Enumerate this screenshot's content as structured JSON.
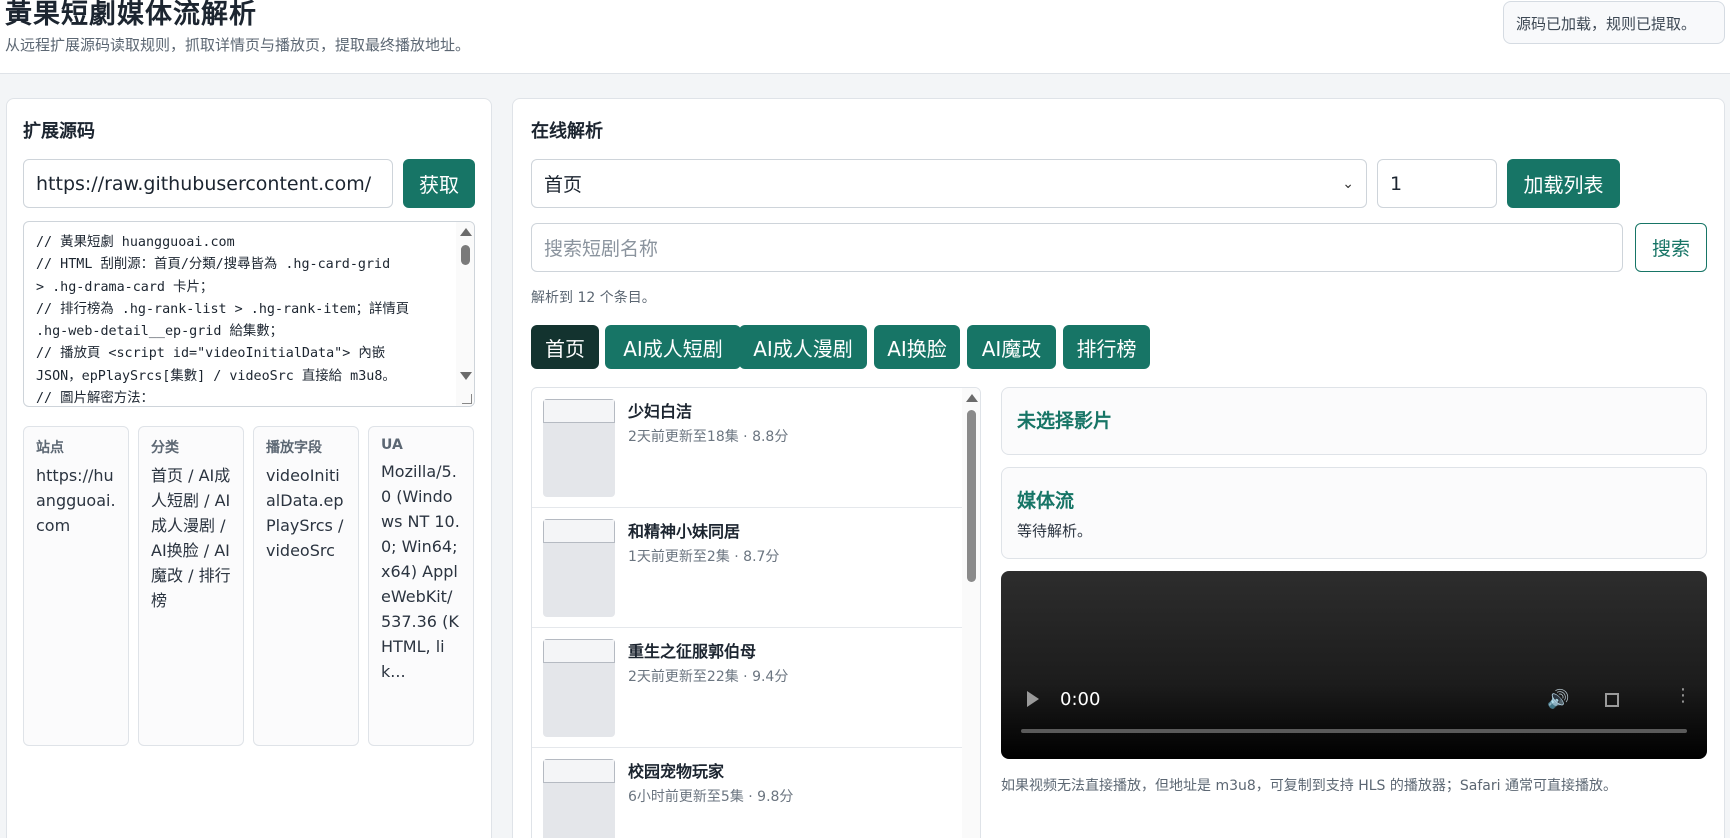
{
  "header": {
    "title": "黃果短劇媒体流解析",
    "subtitle": "从远程扩展源码读取规则，抓取详情页与播放页，提取最终播放地址。",
    "toast": "源码已加载，规则已提取。"
  },
  "left": {
    "title": "扩展源码",
    "url_value": "https://raw.githubusercontent.com/",
    "fetch_label": "获取",
    "code": "// 黃果短劇 huangguoai.com\n// HTML 刮削源：首頁/分類/搜尋皆為 .hg-card-grid\n> .hg-drama-card 卡片；\n// 排行榜為 .hg-rank-list > .hg-rank-item；詳情頁\n.hg-web-detail__ep-grid 給集數；\n// 播放頁 <script id=\"videoInitialData\"> 內嵌\nJSON，epPlaySrcs[集數] / videoSrc 直接給 m3u8。\n// 圖片解密方法：",
    "cards": [
      {
        "key": "站点",
        "value": "https://huangguoai.com"
      },
      {
        "key": "分类",
        "value": "首页 / AI成人短剧 / AI成人漫剧 / AI换脸 / AI魔改 / 排行榜"
      },
      {
        "key": "播放字段",
        "value": "videoInitialData.epPlaySrcs / videoSrc"
      },
      {
        "key": "UA",
        "value": "Mozilla/5.0 (Windows NT 10.0; Win64; x64) AppleWebKit/537.36 (KHTML, lik..."
      }
    ]
  },
  "right": {
    "title": "在线解析",
    "category_select": "首页",
    "page_value": "1",
    "load_label": "加载列表",
    "search_placeholder": "搜索短剧名称",
    "search_label": "搜索",
    "status": "解析到 12 个条目。",
    "categories": [
      "首页",
      "AI成人短剧",
      "AI成人漫剧",
      "AI换脸",
      "AI魔改",
      "排行榜"
    ],
    "items": [
      {
        "name": "少妇白洁",
        "meta": "2天前更新至18集 · 8.8分"
      },
      {
        "name": "和精神小妹同居",
        "meta": "1天前更新至2集 · 8.7分"
      },
      {
        "name": "重生之征服郭伯母",
        "meta": "2天前更新至22集 · 9.4分"
      },
      {
        "name": "校园宠物玩家",
        "meta": "6小时前更新至5集 · 9.8分"
      }
    ],
    "selected_title": "未选择影片",
    "stream_title": "媒体流",
    "stream_text": "等待解析。",
    "video_time": "0:00",
    "hint": "如果视频无法直接播放，但地址是 m3u8，可复制到支持 HLS 的播放器；Safari 通常可直接播放。"
  },
  "colors": {
    "accent": "#177566",
    "accent_dark": "#13332f"
  }
}
